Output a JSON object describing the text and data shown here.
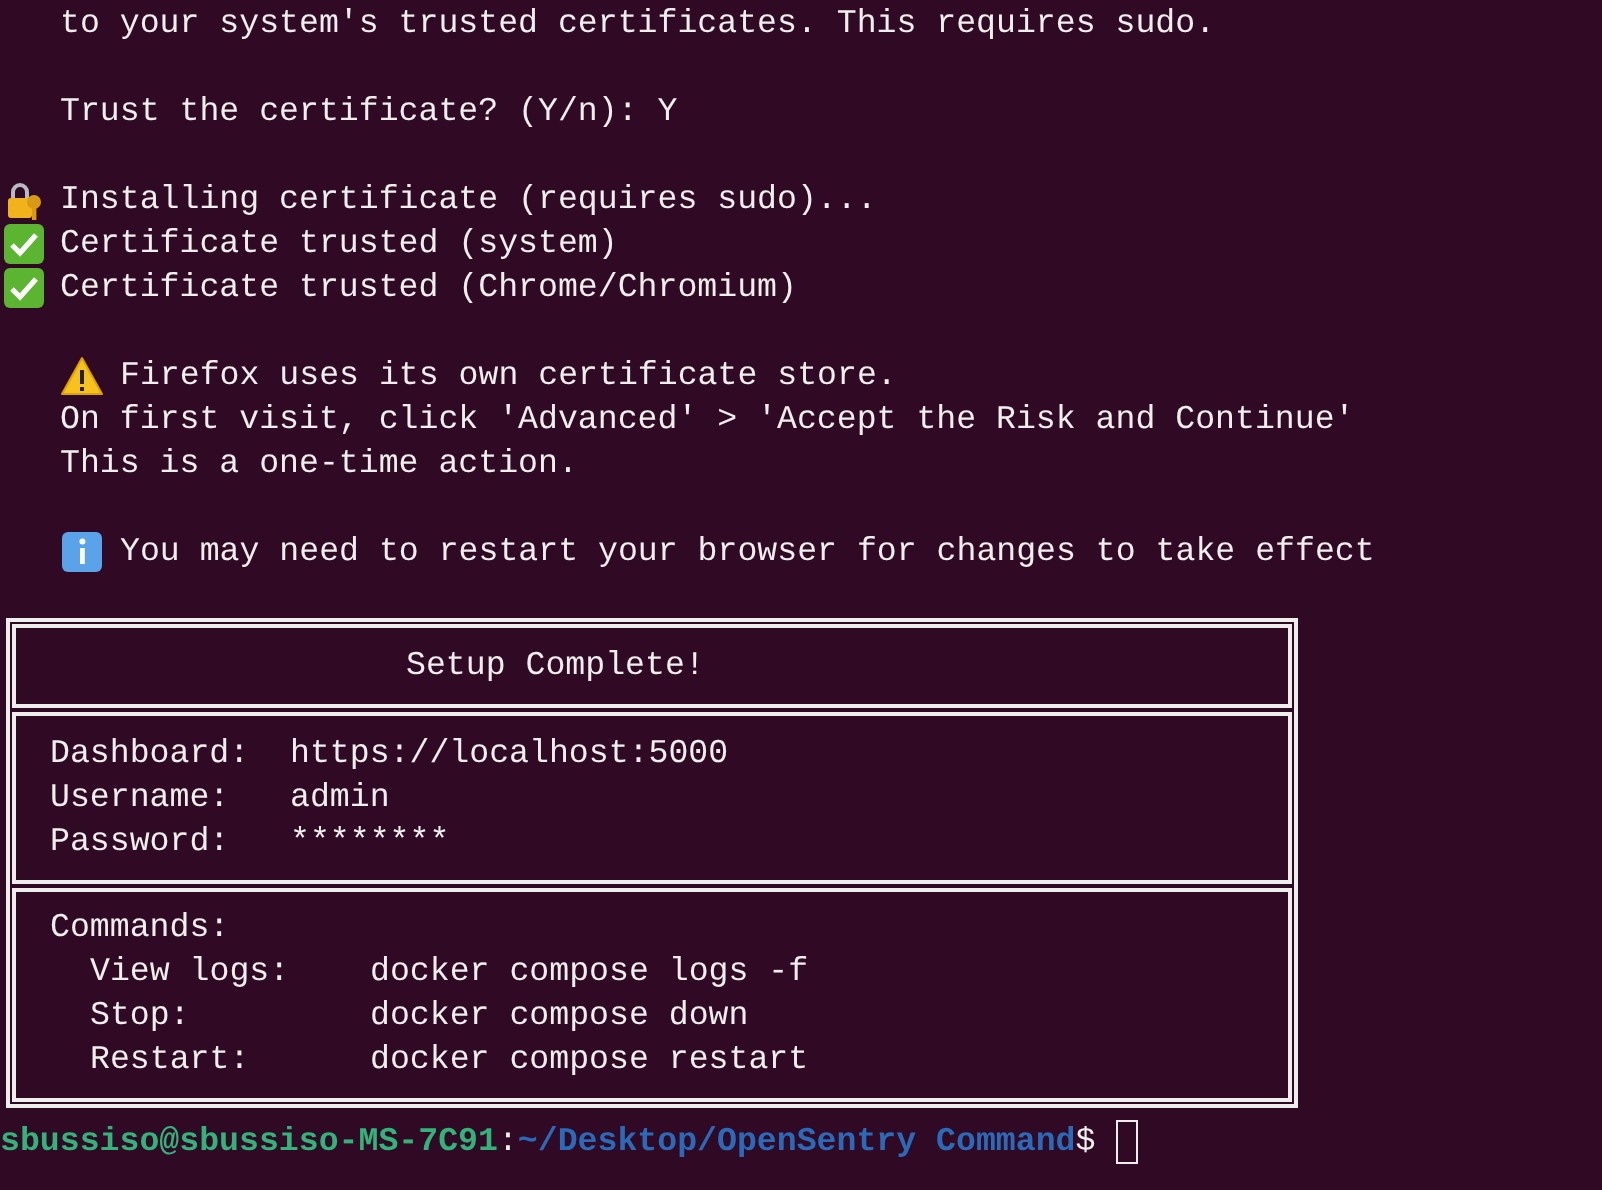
{
  "blocks": [
    [
      {
        "kind": "plain",
        "text": "to your system's trusted certificates. This requires sudo."
      }
    ],
    [
      {
        "kind": "plain",
        "text": "Trust the certificate? (Y/n): Y"
      }
    ],
    [
      {
        "kind": "progress",
        "text": "Installing certificate (requires sudo)..."
      },
      {
        "kind": "success",
        "text": "Certificate trusted (system)"
      },
      {
        "kind": "success",
        "text": "Certificate trusted (Chrome/Chromium)"
      }
    ],
    [
      {
        "kind": "warning",
        "text": "Firefox uses its own certificate store."
      },
      {
        "kind": "plain",
        "text": "On first visit, click 'Advanced' > 'Accept the Risk and Continue'"
      },
      {
        "kind": "plain",
        "text": "This is a one-time action."
      }
    ],
    [
      {
        "kind": "info",
        "text": "You may need to restart your browser for changes to take effect"
      }
    ]
  ],
  "summary_box": {
    "title": "Setup Complete!",
    "details": [
      {
        "label": "Dashboard:",
        "value": "https://localhost:5000"
      },
      {
        "label": "Username:",
        "value": "admin"
      },
      {
        "label": "Password:",
        "value": "********"
      }
    ],
    "commands_heading": "Commands:",
    "commands": [
      {
        "label": "View logs:",
        "value": "docker compose logs -f"
      },
      {
        "label": "Stop:",
        "value": "docker compose down"
      },
      {
        "label": "Restart:",
        "value": "docker compose restart"
      }
    ]
  },
  "prompt": {
    "user_host": "sbussiso@sbussiso-MS-7C91",
    "separator": ":",
    "path": "~/Desktop/OpenSentry Command",
    "symbol": "$"
  }
}
